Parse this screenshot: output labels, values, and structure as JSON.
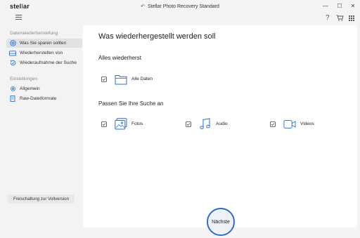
{
  "app": {
    "logo_text": "stellar",
    "title": "Stellar Photo Recovery Standard"
  },
  "window_controls": {
    "minimize": "—",
    "maximize": "☐",
    "close": "✕"
  },
  "toolbar": {
    "help": "?",
    "cart": "cart-icon",
    "grid": "grid-icon"
  },
  "sidebar": {
    "section1": "Datenwiederherstellung",
    "items1": [
      {
        "label": "Was Sie sparen sollten",
        "icon": "target-icon",
        "active": true
      },
      {
        "label": "Wiederherstellen von",
        "icon": "drive-icon",
        "active": false
      },
      {
        "label": "Wiederaufnahme der Suche",
        "icon": "resume-icon",
        "active": false
      }
    ],
    "section2": "Einstellungen",
    "items2": [
      {
        "label": "Allgemein",
        "icon": "gear-icon"
      },
      {
        "label": "Raw-Dateiformate",
        "icon": "file-icon"
      }
    ],
    "unlock_label": "Freischaltung zur Vollversion"
  },
  "main": {
    "title": "Was wiederhergestellt werden soll",
    "section_all": "Alles wiederherst",
    "all_data_label": "Alle Daten",
    "section_custom": "Passen Sie Ihre Suche an",
    "options": [
      {
        "label": "Fotos",
        "icon": "photo-icon",
        "checked": true
      },
      {
        "label": "Audio",
        "icon": "music-icon",
        "checked": true
      },
      {
        "label": "Videos",
        "icon": "video-icon",
        "checked": true
      }
    ]
  },
  "next_button": "Nächste",
  "colors": {
    "accent": "#2d66d6",
    "icon_blue": "#1f6fd6"
  }
}
